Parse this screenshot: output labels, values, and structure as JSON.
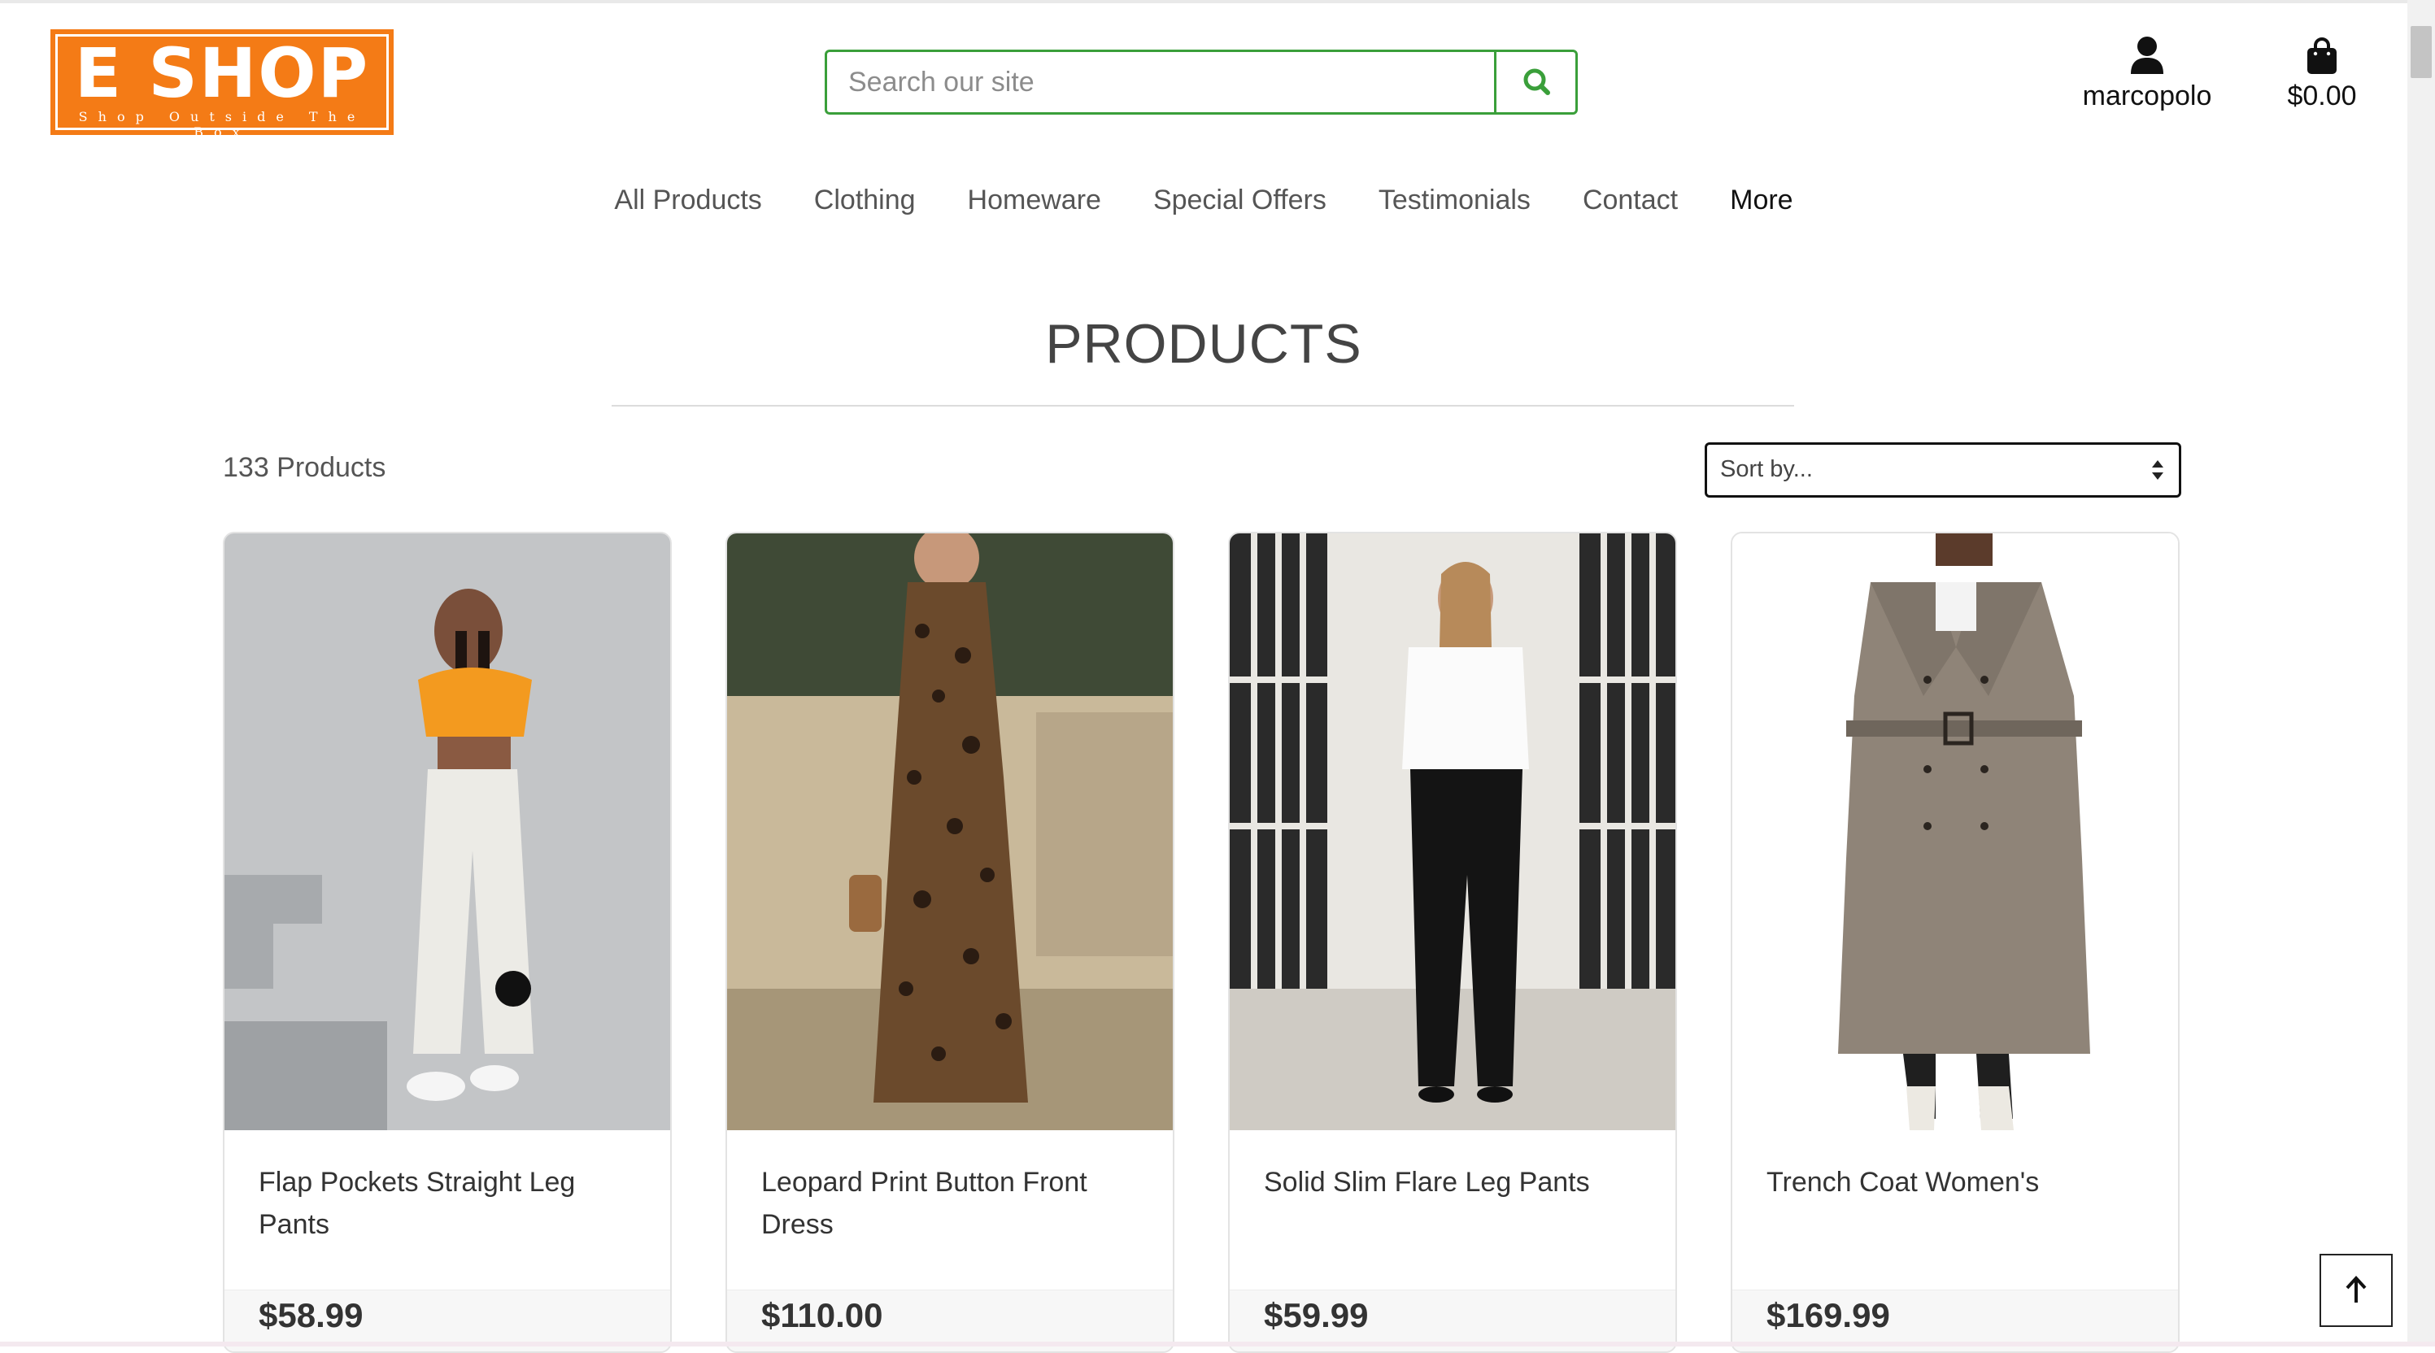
{
  "brand": {
    "name": "E SHOP",
    "tagline": "Shop Outside The Box",
    "color": "#f47b16"
  },
  "search": {
    "placeholder": "Search our site",
    "icon": "search-icon"
  },
  "account": {
    "label": "marcopolo",
    "icon": "user-icon"
  },
  "bag": {
    "total": "$0.00",
    "icon": "shopping-bag-icon"
  },
  "nav": {
    "items": [
      "All Products",
      "Clothing",
      "Homeware",
      "Special Offers",
      "Testimonials",
      "Contact",
      "More"
    ]
  },
  "page": {
    "title": "PRODUCTS",
    "count": "133 Products"
  },
  "sort": {
    "selected": "Sort by...",
    "icon": "sort-arrows-icon"
  },
  "products": [
    {
      "name": "Flap Pockets Straight Leg Pants",
      "price": "$58.99"
    },
    {
      "name": "Leopard Print Button Front Dress",
      "price": "$110.00"
    },
    {
      "name": "Solid Slim Flare Leg Pants",
      "price": "$59.99"
    },
    {
      "name": "Trench Coat Women's",
      "price": "$169.99"
    }
  ],
  "scroll_top": {
    "icon": "arrow-up-icon"
  },
  "colors": {
    "accent_green": "#3a9f3a",
    "text": "#333333"
  }
}
